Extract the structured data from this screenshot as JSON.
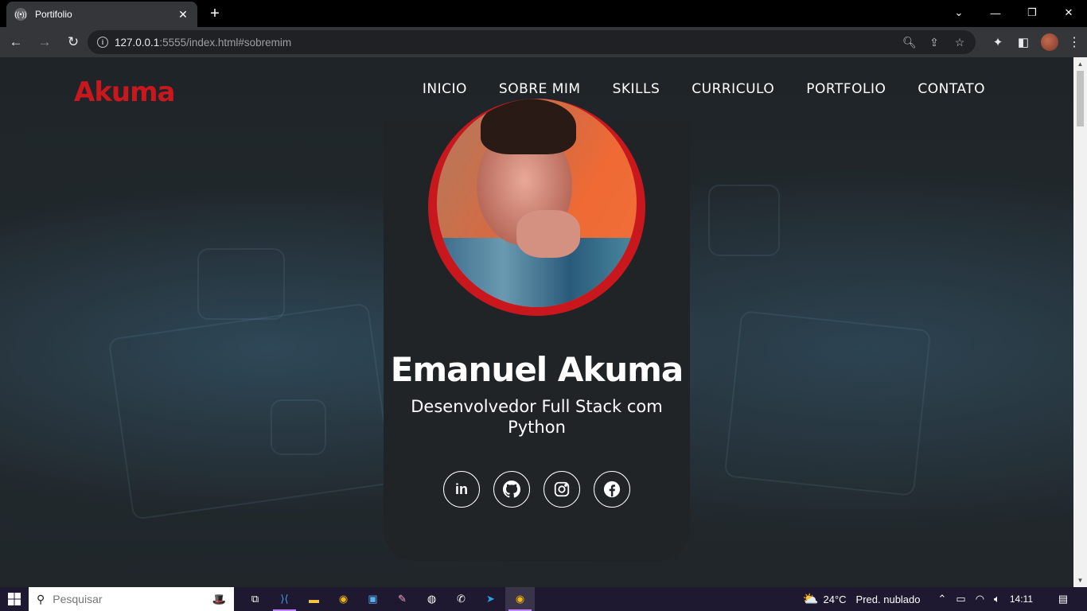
{
  "browser": {
    "tab_title": "Portifolio",
    "url_host": "127.0.0.1",
    "url_rest": ":5555/index.html#sobremim"
  },
  "site": {
    "logo": "Akuma",
    "nav": [
      "INICIO",
      "SOBRE MIM",
      "SKILLS",
      "CURRICULO",
      "PORTFOLIO",
      "CONTATO"
    ],
    "name": "Emanuel Akuma",
    "role": "Desenvolvedor Full Stack com Python",
    "socials": [
      "linkedin-icon",
      "github-icon",
      "instagram-icon",
      "facebook-icon"
    ],
    "accent_color": "#c8181e",
    "card_color": "#202426"
  },
  "taskbar": {
    "search_placeholder": "Pesquisar",
    "temperature": "24°C",
    "weather": "Pred. nublado",
    "time": "14:11"
  }
}
